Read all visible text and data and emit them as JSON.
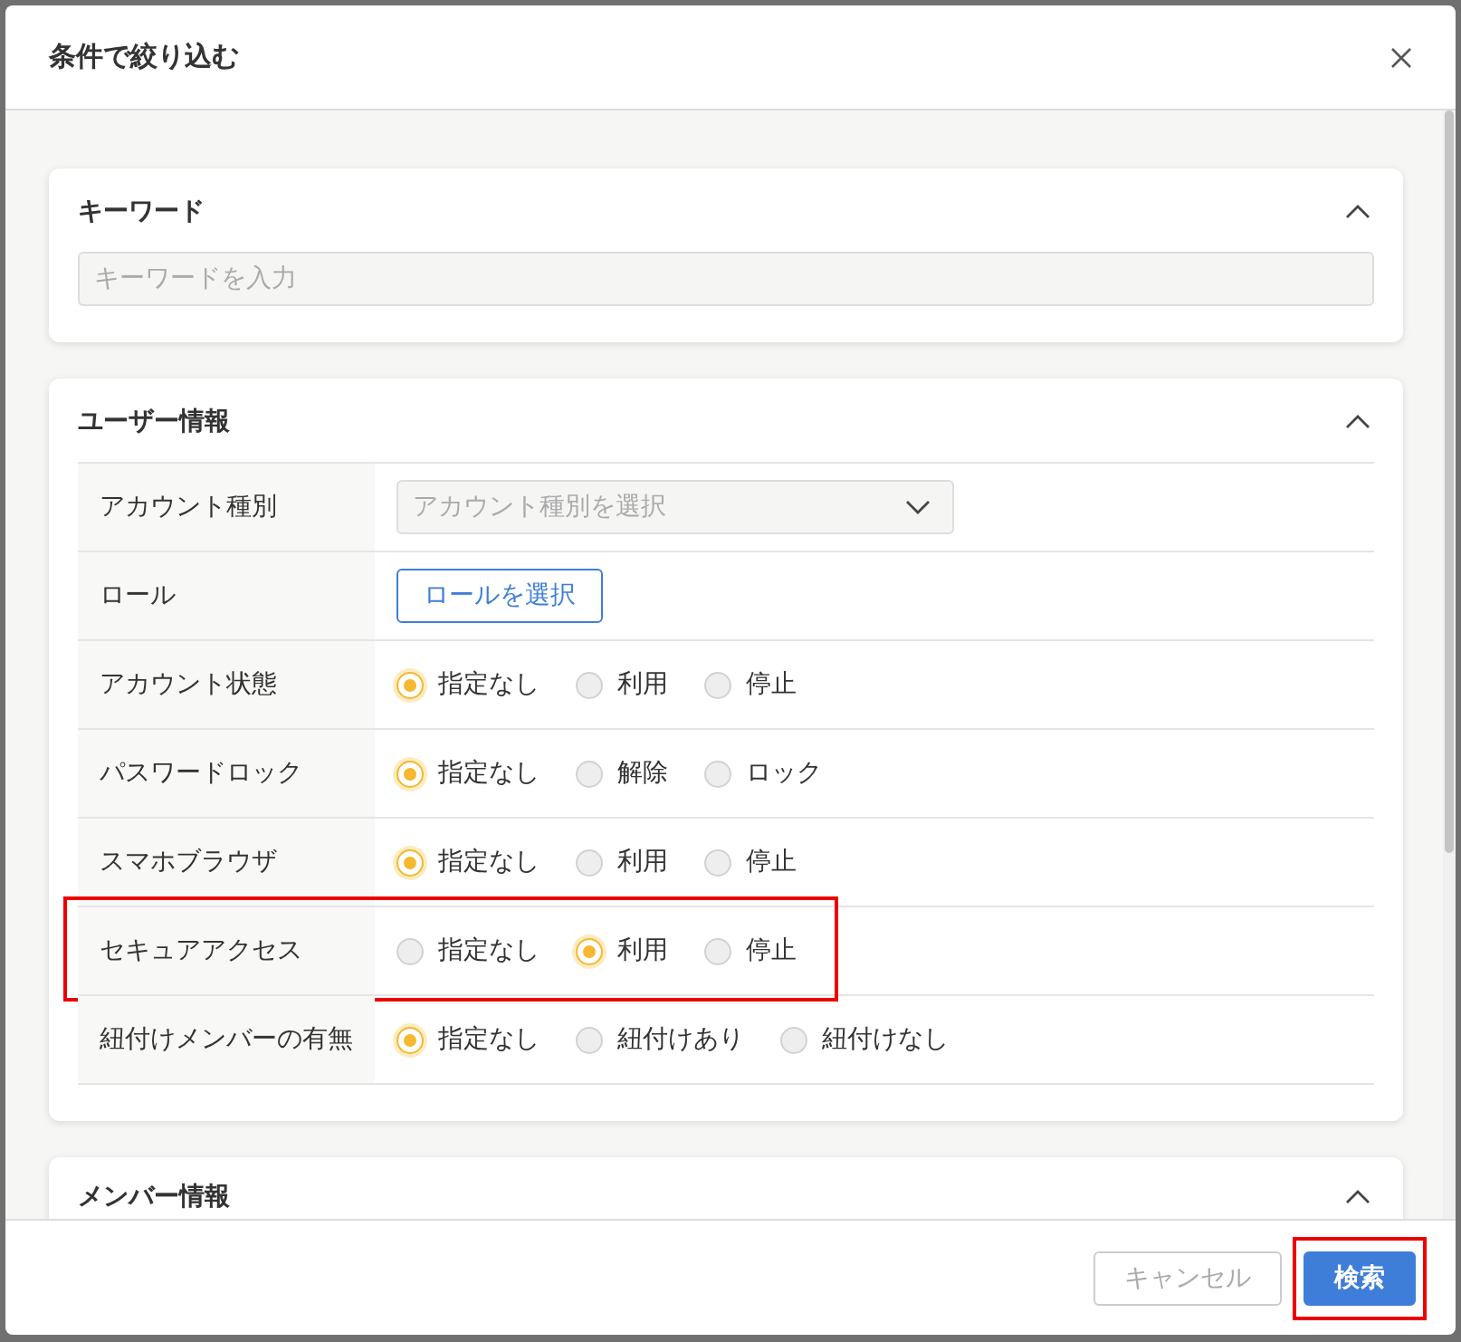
{
  "dialog": {
    "title": "条件で絞り込む"
  },
  "sections": [
    {
      "title": "キーワード",
      "expanded": true,
      "kind": "keyword",
      "field": {
        "placeholder": "キーワードを入力"
      }
    },
    {
      "title": "ユーザー情報",
      "expanded": true,
      "kind": "table",
      "rows": [
        {
          "kind": "dropdown",
          "label": "アカウント種別",
          "placeholder": "アカウント種別を選択",
          "highlighted": false
        },
        {
          "kind": "button",
          "label": "ロール",
          "button": "ロールを選択",
          "highlighted": false
        },
        {
          "kind": "radio",
          "label": "アカウント状態",
          "highlighted": false,
          "options": [
            {
              "label": "指定なし",
              "selected": true
            },
            {
              "label": "利用",
              "selected": false
            },
            {
              "label": "停止",
              "selected": false
            }
          ]
        },
        {
          "kind": "radio",
          "label": "パスワードロック",
          "highlighted": false,
          "options": [
            {
              "label": "指定なし",
              "selected": true
            },
            {
              "label": "解除",
              "selected": false
            },
            {
              "label": "ロック",
              "selected": false
            }
          ]
        },
        {
          "kind": "radio",
          "label": "スマホブラウザ",
          "highlighted": false,
          "options": [
            {
              "label": "指定なし",
              "selected": true
            },
            {
              "label": "利用",
              "selected": false
            },
            {
              "label": "停止",
              "selected": false
            }
          ]
        },
        {
          "kind": "radio",
          "label": "セキュアアクセス",
          "highlighted": true,
          "options": [
            {
              "label": "指定なし",
              "selected": false
            },
            {
              "label": "利用",
              "selected": true
            },
            {
              "label": "停止",
              "selected": false
            }
          ]
        },
        {
          "kind": "radio",
          "label": "紐付けメンバーの有無",
          "highlighted": false,
          "options": [
            {
              "label": "指定なし",
              "selected": true
            },
            {
              "label": "紐付けあり",
              "selected": false
            },
            {
              "label": "紐付けなし",
              "selected": false
            }
          ]
        }
      ]
    },
    {
      "title": "メンバー情報",
      "expanded": true,
      "kind": "header"
    }
  ],
  "footer": {
    "buttons": [
      {
        "label": "キャンセル",
        "kind": "cancel",
        "disabled": true,
        "highlighted": false
      },
      {
        "label": "検索",
        "kind": "primary",
        "disabled": false,
        "highlighted": true
      }
    ]
  }
}
